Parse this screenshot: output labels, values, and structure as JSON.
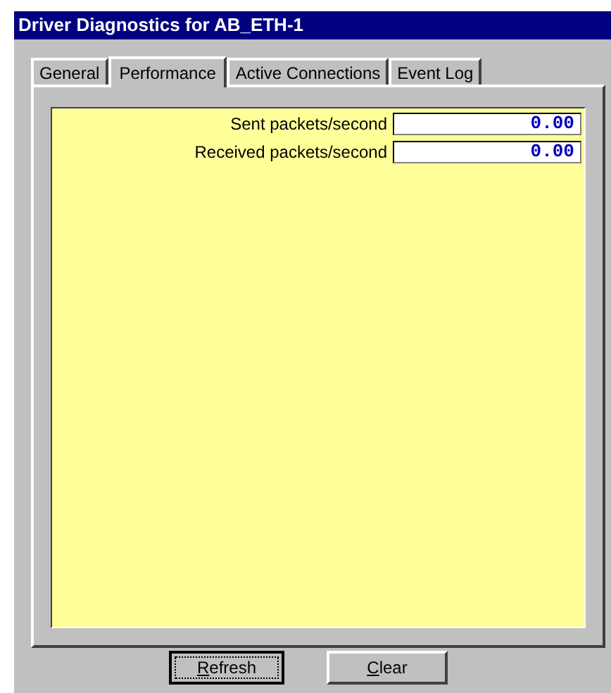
{
  "window": {
    "title": "Driver Diagnostics for AB_ETH-1"
  },
  "tabs": [
    {
      "label": "General",
      "selected": false
    },
    {
      "label": "Performance",
      "selected": true
    },
    {
      "label": "Active Connections",
      "selected": false
    },
    {
      "label": "Event Log",
      "selected": false
    }
  ],
  "counters": [
    {
      "label": "Sent packets/second",
      "value": "0.00"
    },
    {
      "label": "Received packets/second",
      "value": "0.00"
    }
  ],
  "buttons": [
    {
      "label": "Refresh",
      "focused": true
    },
    {
      "label": "Clear",
      "focused": false
    }
  ]
}
